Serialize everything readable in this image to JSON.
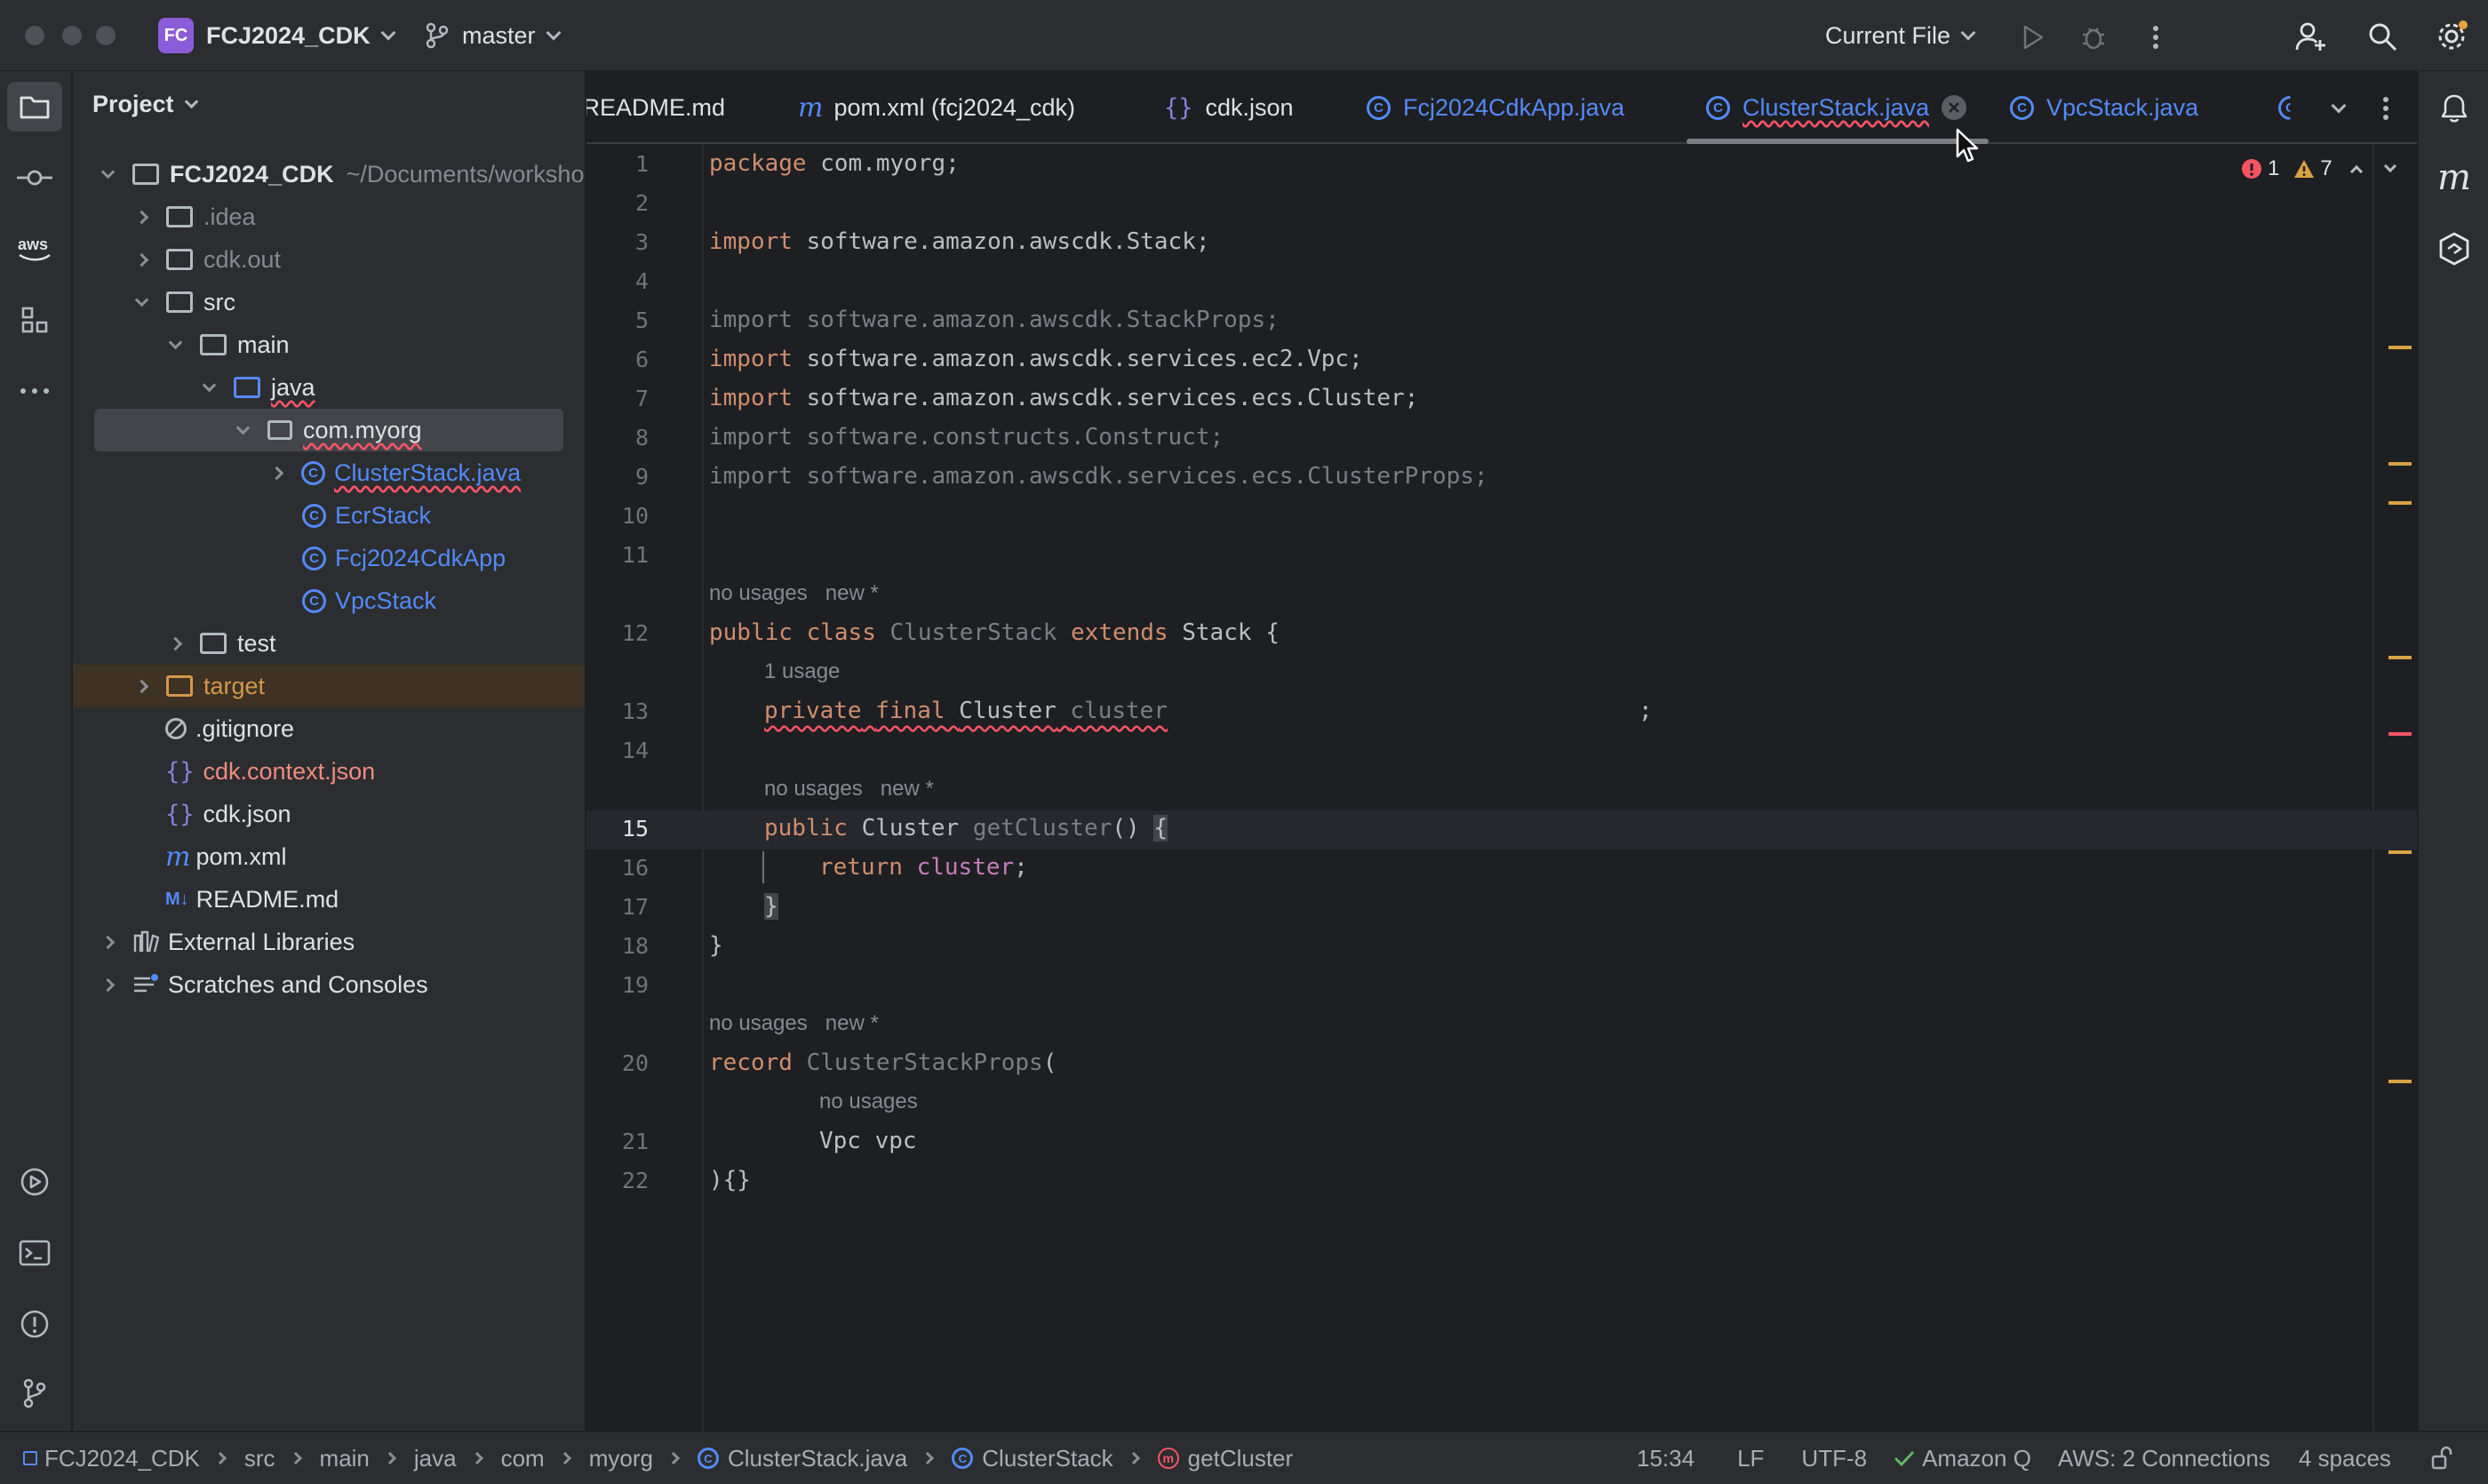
{
  "titlebar": {
    "project_badge": "FC",
    "project_name": "FCJ2024_CDK",
    "branch": "master",
    "run_config": "Current File"
  },
  "project_panel": {
    "title": "Project",
    "root_name": "FCJ2024_CDK",
    "root_path": "~/Documents/worksho",
    "items": [
      {
        "label": ".idea"
      },
      {
        "label": "cdk.out"
      },
      {
        "label": "src"
      },
      {
        "label": "main"
      },
      {
        "label": "java"
      },
      {
        "label": "com.myorg"
      },
      {
        "label": "ClusterStack.java"
      },
      {
        "label": "EcrStack"
      },
      {
        "label": "Fcj2024CdkApp"
      },
      {
        "label": "VpcStack"
      },
      {
        "label": "test"
      },
      {
        "label": "target"
      },
      {
        "label": ".gitignore"
      },
      {
        "label": "cdk.context.json"
      },
      {
        "label": "cdk.json"
      },
      {
        "label": "pom.xml"
      },
      {
        "label": "README.md"
      },
      {
        "label": "External Libraries"
      },
      {
        "label": "Scratches and Consoles"
      }
    ]
  },
  "tabs": [
    {
      "label": "README.md"
    },
    {
      "label": "pom.xml (fcj2024_cdk)"
    },
    {
      "label": "cdk.json"
    },
    {
      "label": "Fcj2024CdkApp.java"
    },
    {
      "label": "ClusterStack.java"
    },
    {
      "label": "VpcStack.java"
    }
  ],
  "inspections": {
    "errors": "1",
    "warnings": "7"
  },
  "code": {
    "l1a": "package",
    "l1b": " com.myorg;",
    "l3a": "import",
    "l3b": " software.amazon.awscdk.Stack;",
    "l5": "import software.amazon.awscdk.StackProps;",
    "l6a": "import",
    "l6b": " software.amazon.awscdk.services.ec2.Vpc;",
    "l7a": "import",
    "l7b": " software.amazon.awscdk.services.ecs.Cluster;",
    "l8": "import software.constructs.Construct;",
    "l9": "import software.amazon.awscdk.services.ecs.ClusterProps;",
    "hint_no_usages": "no usages",
    "hint_new": "new *",
    "hint_1_usage": "1 usage",
    "kw_public": "public",
    "kw_class": "class",
    "kw_extends": "extends",
    "kw_private": "private",
    "kw_final": "final",
    "kw_return": "return",
    "kw_record": "record",
    "cls_name": "ClusterStack",
    "stack": "Stack",
    "brace_open": "{",
    "type_cluster": "Cluster",
    "fld_cluster": "cluster",
    "semi": ";",
    "method_name": "getCluster",
    "parens": "()",
    "close_brace": "}",
    "record_name": "ClusterStackProps",
    "paren_open": "(",
    "vpc_line": "Vpc vpc",
    "record_end": "){}",
    "line_numbers": [
      "1",
      "2",
      "3",
      "4",
      "5",
      "6",
      "7",
      "8",
      "9",
      "10",
      "11",
      "12",
      "13",
      "14",
      "15",
      "16",
      "17",
      "18",
      "19",
      "20",
      "21",
      "22"
    ]
  },
  "breadcrumb": [
    "FCJ2024_CDK",
    "src",
    "main",
    "java",
    "com",
    "myorg",
    "ClusterStack.java",
    "ClusterStack",
    "getCluster"
  ],
  "status": {
    "position": "15:34",
    "line_sep": "LF",
    "encoding": "UTF-8",
    "amazon_q": "Amazon Q",
    "aws": "AWS: 2 Connections",
    "indent": "4 spaces"
  },
  "colors": {
    "accent_blue": "#548af7",
    "keyword": "#cf8e6d",
    "field": "#c77dbb",
    "warning": "#d9a343",
    "error": "#f75464",
    "target_folder": "#d5964a"
  }
}
